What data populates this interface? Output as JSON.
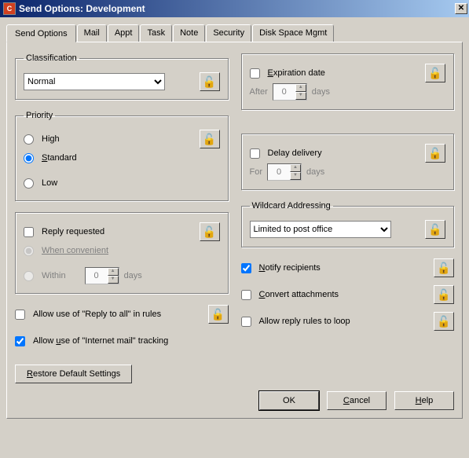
{
  "title": "Send Options:  Development",
  "tabs": {
    "send_options": "Send Options",
    "mail": "Mail",
    "appt": "Appt",
    "task": "Task",
    "note": "Note",
    "security": "Security",
    "disk": "Disk Space Mgmt"
  },
  "classification": {
    "legend": "Classification",
    "value": "Normal"
  },
  "priority": {
    "legend": "Priority",
    "high": "High",
    "standard": "Standard",
    "low": "Low"
  },
  "reply": {
    "requested": "Reply requested",
    "when": "When convenient",
    "within": "Within",
    "days": "days",
    "within_value": "0"
  },
  "reply_all_rules": "Allow use of \"Reply to all\" in rules",
  "internet_tracking": "Allow use of \"Internet mail\" tracking",
  "restore": "Restore Default Settings",
  "expiration": {
    "label": "Expiration date",
    "after": "After",
    "days": "days",
    "value": "0"
  },
  "delay": {
    "label": "Delay delivery",
    "for": "For",
    "days": "days",
    "value": "0"
  },
  "wildcard": {
    "legend": "Wildcard Addressing",
    "value": "Limited to post office"
  },
  "notify": "Notify recipients",
  "convert": "Convert attachments",
  "allow_loop": "Allow reply rules to loop",
  "buttons": {
    "ok": "OK",
    "cancel": "Cancel",
    "help": "Help"
  }
}
